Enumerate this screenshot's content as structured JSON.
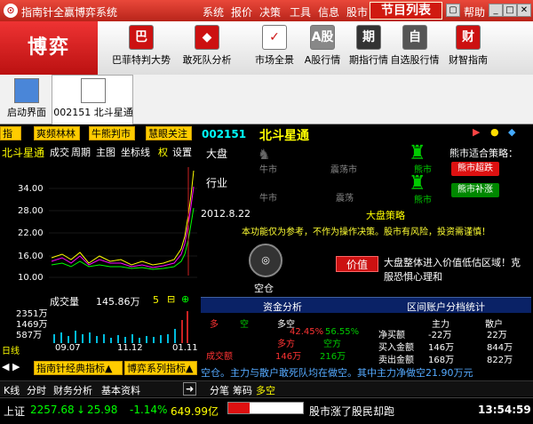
{
  "window": {
    "title": "指南针全赢博弈系统",
    "program_list": "节目列表",
    "help": "帮助"
  },
  "menus": [
    "系统",
    "报价",
    "决策",
    "工具",
    "信息",
    "股市"
  ],
  "toolbar": {
    "brand": "博弈",
    "buttons": [
      {
        "label": "巴菲特判大势",
        "icon": "巴",
        "color": "#cc1111"
      },
      {
        "label": "敢死队分析",
        "icon": "◆",
        "color": "#cc1111"
      },
      {
        "label": "市场全景",
        "icon": "✓",
        "color": "#ffffff"
      },
      {
        "label": "A股行情",
        "icon": "A股",
        "color": "#888888"
      },
      {
        "label": "期指行情",
        "icon": "期",
        "color": "#333333"
      },
      {
        "label": "自选股行情",
        "icon": "自",
        "color": "#555555"
      },
      {
        "label": "财智指南",
        "icon": "财",
        "color": "#cc1111"
      }
    ]
  },
  "pages": [
    {
      "label": "启动界面"
    },
    {
      "label": "002151 北斗星通"
    }
  ],
  "left": {
    "tabs": [
      "指数",
      "爽频林林",
      "牛熊判市",
      "慧眼关注"
    ],
    "stock_name": "北斗星通",
    "mode": "成交",
    "periods": [
      "周期",
      "主图",
      "坐标线",
      "权",
      "设置"
    ],
    "y_labels": [
      "34.00",
      "28.00",
      "22.00",
      "16.00",
      "10.00"
    ],
    "volume_label": "成交量",
    "volume_value": "145.86万",
    "volume_num": "5",
    "vol_labels": [
      "2351万",
      "1469万",
      "587万"
    ],
    "dates": [
      "09.07",
      "11.12",
      "01.11"
    ],
    "period_tab": "日线",
    "bottom_buttons": [
      "指南针经典指标▲",
      "博弈系列指标▲"
    ]
  },
  "right": {
    "code": "002151",
    "name": "北斗星通",
    "dapan": "大盘",
    "hangye": "行业",
    "niu": "牛市",
    "zhendang": "震荡市",
    "xiong": "熊市",
    "niu2": "牛市",
    "zhendang2": "震荡",
    "xiong2": "熊市",
    "strategy_title": "熊市适合策略：",
    "pill1": "熊市超跌",
    "pill2": "熊市补涨",
    "date": "2012.8.22",
    "strategy": "大盘策略",
    "disclaimer": "本功能仅为参考，不作为操作决策。股市有风险，投资需谨慎！",
    "kongcang": "空仓",
    "jiazhi": "价值",
    "advice": "大盘整体进入价值低估区域！克服恐惧心理和",
    "tabs": [
      "资金分析",
      "区间账户分档统计"
    ],
    "legend_duo": "多",
    "legend_kong": "空",
    "duokong": "多空",
    "pct1": "42.45%",
    "pct2": "56.55%",
    "duofang": "多方",
    "kongfang": "空方",
    "chengjiao": "成交额",
    "amt1": "146万",
    "amt2": "216万",
    "table_headers": [
      "",
      "主力",
      "散户"
    ],
    "rows": [
      [
        "净买额",
        "-22万",
        "22万"
      ],
      [
        "买入金额",
        "146万",
        "844万"
      ],
      [
        "卖出金额",
        "168万",
        "822万"
      ]
    ],
    "marquee": "空仓。主力与散户敢死队均在做空。其中主力净做空21.90万元"
  },
  "nav": {
    "items": [
      "K线",
      "分时",
      "财务分析",
      "基本资料"
    ],
    "right": [
      "分笔",
      "筹码",
      "多空"
    ]
  },
  "status": {
    "index": "上证",
    "value": "2257.68",
    "change": "25.98",
    "pct": "-1.14%",
    "amount": "649.99亿",
    "news": "股市涨了股民却跑",
    "time": "13:54:59"
  }
}
